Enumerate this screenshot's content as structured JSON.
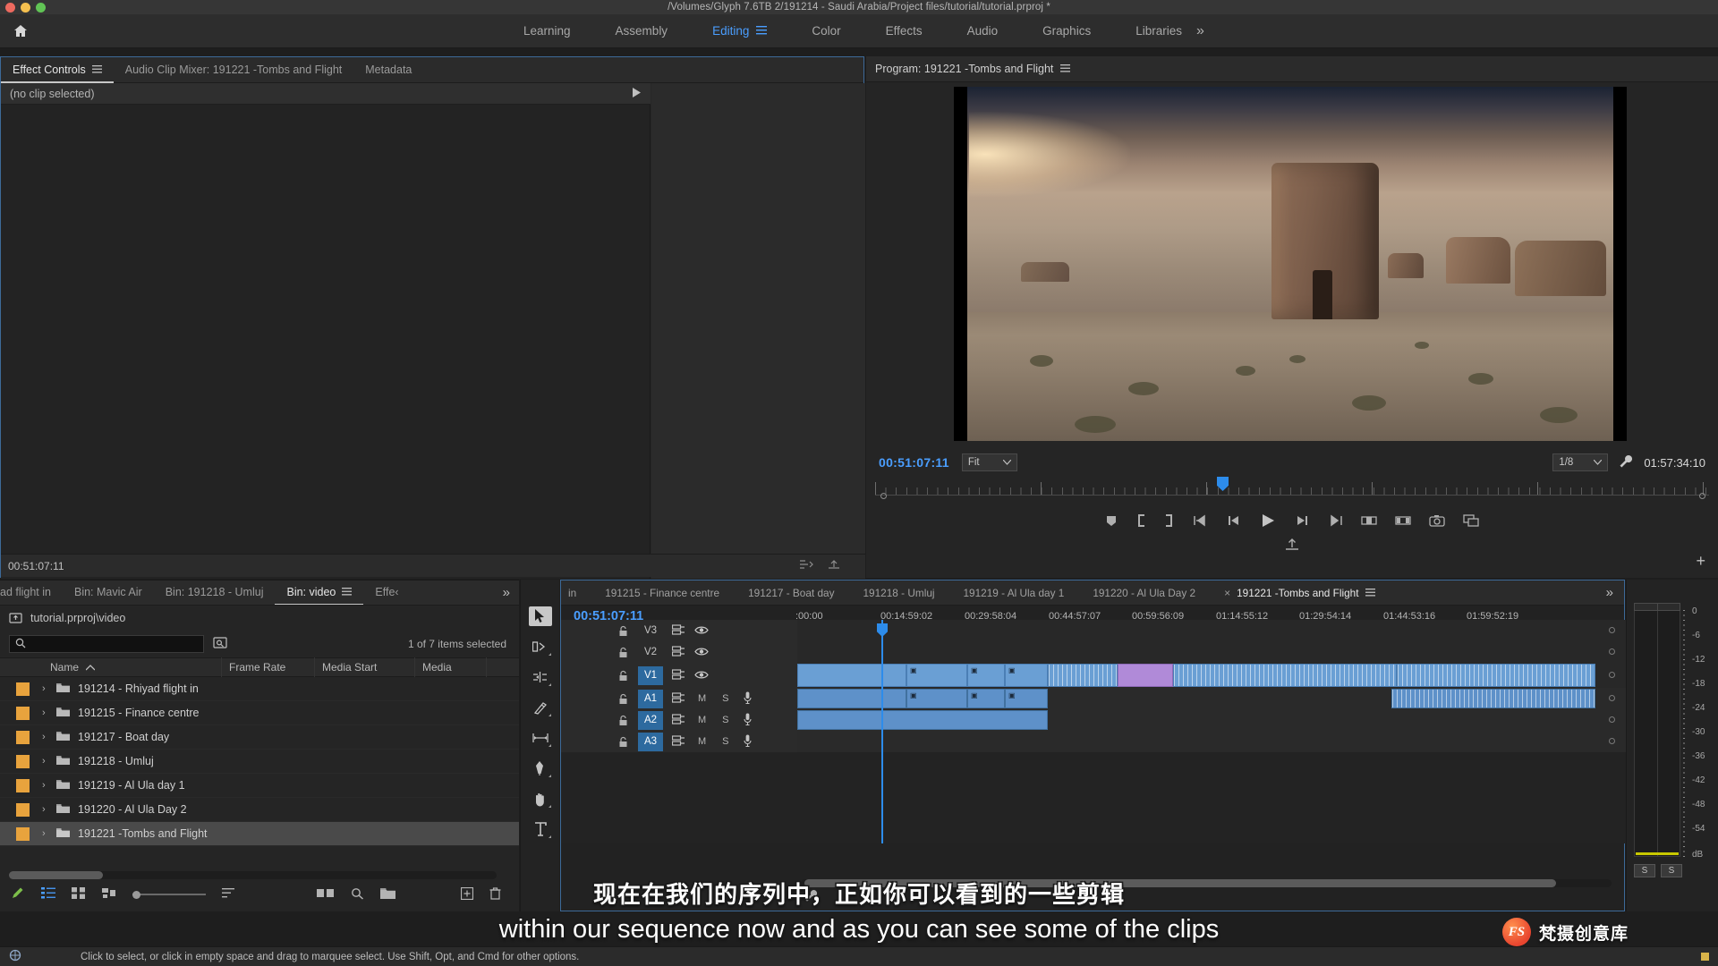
{
  "window": {
    "title": "/Volumes/Glyph 7.6TB 2/191214 - Saudi Arabia/Project files/tutorial/tutorial.prproj *",
    "controls": {
      "close": "close",
      "minimize": "minimize",
      "maximize": "maximize"
    }
  },
  "workspace": {
    "home_icon": "home-icon",
    "tabs": [
      {
        "label": "Learning",
        "active": false
      },
      {
        "label": "Assembly",
        "active": false
      },
      {
        "label": "Editing",
        "active": true,
        "menu_icon": "burger-menu-icon"
      },
      {
        "label": "Color",
        "active": false
      },
      {
        "label": "Effects",
        "active": false
      },
      {
        "label": "Audio",
        "active": false
      },
      {
        "label": "Graphics",
        "active": false
      },
      {
        "label": "Libraries",
        "active": false
      }
    ],
    "overflow_label": "»"
  },
  "effect_controls": {
    "tabs": [
      {
        "label": "Effect Controls",
        "active": true,
        "menu_icon": "burger-menu-icon"
      },
      {
        "label": "Audio Clip Mixer: 191221 -Tombs and Flight",
        "active": false
      },
      {
        "label": "Metadata",
        "active": false
      }
    ],
    "clip_status": "(no clip selected)",
    "expand_icon": "play-triangle-icon",
    "timecode": "00:51:07:11"
  },
  "program_monitor": {
    "title": "Program: 191221 -Tombs and Flight",
    "menu_icon": "burger-menu-icon",
    "current_timecode": "00:51:07:11",
    "zoom_level": "Fit",
    "resolution": "1/8",
    "settings_icon": "wrench-icon",
    "duration_timecode": "01:57:34:10",
    "transport": [
      {
        "name": "add-marker-button",
        "glyph": "marker"
      },
      {
        "name": "mark-in-button",
        "glyph": "mark-in"
      },
      {
        "name": "mark-out-button",
        "glyph": "mark-out"
      },
      {
        "name": "go-to-in-button",
        "glyph": "go-to-in"
      },
      {
        "name": "step-back-button",
        "glyph": "step-back"
      },
      {
        "name": "play-stop-button",
        "glyph": "play"
      },
      {
        "name": "step-forward-button",
        "glyph": "step-forward"
      },
      {
        "name": "go-to-out-button",
        "glyph": "go-to-out"
      },
      {
        "name": "lift-button",
        "glyph": "lift"
      },
      {
        "name": "extract-button",
        "glyph": "extract"
      },
      {
        "name": "export-frame-button",
        "glyph": "camera"
      },
      {
        "name": "comparison-view-button",
        "glyph": "compare"
      }
    ],
    "export_icon": "export-icon",
    "plus_icon": "plus-icon"
  },
  "project_panel": {
    "tabs": [
      {
        "label": "ad flight in",
        "active": false
      },
      {
        "label": "Bin: Mavic Air",
        "active": false
      },
      {
        "label": "Bin: 191218 - Umluj",
        "active": false
      },
      {
        "label": "Bin: video",
        "active": true,
        "menu_icon": "burger-menu-icon"
      },
      {
        "label": "Effe‹",
        "active": false
      }
    ],
    "overflow_label": "»",
    "breadcrumb": "tutorial.prproj\\video",
    "breadcrumb_icon": "folder-up-icon",
    "search_placeholder": "",
    "search_value": "",
    "search_icon": "search-icon",
    "filter_icon": "find-icon",
    "selection_status": "1 of 7 items selected",
    "columns": [
      "Name",
      "Frame Rate",
      "Media Start",
      "Media"
    ],
    "sort_icon": "sort-ascending-icon",
    "rows": [
      {
        "name": "191214 - Rhiyad flight in",
        "frame_rate": "",
        "media_start": "",
        "media": "",
        "selected": false
      },
      {
        "name": "191215 - Finance centre",
        "frame_rate": "",
        "media_start": "",
        "media": "",
        "selected": false
      },
      {
        "name": "191217 - Boat day",
        "frame_rate": "",
        "media_start": "",
        "media": "",
        "selected": false
      },
      {
        "name": "191218 - Umluj",
        "frame_rate": "",
        "media_start": "",
        "media": "",
        "selected": false
      },
      {
        "name": "191219 - Al Ula day 1",
        "frame_rate": "",
        "media_start": "",
        "media": "",
        "selected": false
      },
      {
        "name": "191220 - Al Ula Day 2",
        "frame_rate": "",
        "media_start": "",
        "media": "",
        "selected": false
      },
      {
        "name": "191221 -Tombs and Flight",
        "frame_rate": "",
        "media_start": "",
        "media": "",
        "selected": true
      }
    ],
    "toolbar": [
      {
        "name": "new-item-pen-icon"
      },
      {
        "name": "list-view-icon"
      },
      {
        "name": "icon-view-icon"
      },
      {
        "name": "freeform-view-icon"
      },
      {
        "name": "zoom-slider"
      },
      {
        "name": "sort-icon"
      },
      {
        "name": "automate-to-sequence-icon"
      },
      {
        "name": "find-icon"
      },
      {
        "name": "new-bin-icon"
      },
      {
        "name": "new-item-icon"
      },
      {
        "name": "delete-icon"
      }
    ]
  },
  "tools": [
    {
      "name": "selection-tool",
      "glyph": "▶",
      "active": true
    },
    {
      "name": "track-select-forward-tool",
      "glyph": "track-select"
    },
    {
      "name": "ripple-edit-tool",
      "glyph": "ripple"
    },
    {
      "name": "razor-tool",
      "glyph": "razor"
    },
    {
      "name": "slip-tool",
      "glyph": "slip"
    },
    {
      "name": "pen-tool",
      "glyph": "pen"
    },
    {
      "name": "hand-tool",
      "glyph": "hand"
    },
    {
      "name": "type-tool",
      "glyph": "T"
    }
  ],
  "timeline": {
    "tabs": [
      {
        "label": "in",
        "active": false
      },
      {
        "label": "191215 - Finance centre",
        "active": false
      },
      {
        "label": "191217 - Boat day",
        "active": false
      },
      {
        "label": "191218 - Umluj",
        "active": false
      },
      {
        "label": "191219 - Al Ula day 1",
        "active": false
      },
      {
        "label": "191220 - Al Ula Day 2",
        "active": false
      },
      {
        "label": "191221 -Tombs and Flight",
        "active": true,
        "closable": true,
        "menu_icon": "burger-menu-icon"
      }
    ],
    "overflow_label": "»",
    "current_timecode": "00:51:07:11",
    "header_tools": [
      {
        "name": "sequence-settings-icon"
      },
      {
        "name": "snap-icon"
      },
      {
        "name": "linked-selection-icon"
      },
      {
        "name": "add-marker-icon"
      },
      {
        "name": "timeline-display-settings-icon"
      }
    ],
    "ruler_labels": [
      ":00:00",
      "00:14:59:02",
      "00:29:58:04",
      "00:44:57:07",
      "00:59:56:09",
      "01:14:55:12",
      "01:29:54:14",
      "01:44:53:16",
      "01:59:52:19"
    ],
    "tracks": [
      {
        "id": "V3",
        "type": "video",
        "lock": "unlocked",
        "targeted": false,
        "sync": true,
        "eye": true
      },
      {
        "id": "V2",
        "type": "video",
        "lock": "unlocked",
        "targeted": false,
        "sync": true,
        "eye": true
      },
      {
        "id": "V1",
        "type": "video",
        "lock": "unlocked",
        "targeted": true,
        "sync": true,
        "eye": true
      },
      {
        "id": "A1",
        "type": "audio",
        "lock": "unlocked",
        "targeted": true,
        "sync": true,
        "mute": "M",
        "solo": "S",
        "mic": true
      },
      {
        "id": "A2",
        "type": "audio",
        "lock": "unlocked",
        "targeted": true,
        "sync": true,
        "mute": "M",
        "solo": "S",
        "mic": true
      },
      {
        "id": "A3",
        "type": "audio",
        "lock": "unlocked",
        "targeted": true,
        "sync": true,
        "mute": "M",
        "solo": "S",
        "mic": true
      }
    ]
  },
  "audio_meter": {
    "scale": [
      "0",
      "-6",
      "-12",
      "-18",
      "-24",
      "-30",
      "-36",
      "-42",
      "-48",
      "-54",
      "dB"
    ],
    "solo_buttons": [
      "S",
      "S"
    ]
  },
  "status_bar": {
    "icon": "selection-hint-icon",
    "message": "Click to select, or click in empty space and drag to marquee select. Use Shift, Opt, and Cmd for other options."
  },
  "subtitles": {
    "chinese": "现在在我们的序列中，正如你可以看到的一些剪辑",
    "english": "within our sequence now and as you can see some of the clips"
  },
  "watermark": {
    "logo_text": "FS",
    "brand": "梵摄创意库"
  },
  "colors": {
    "accent_blue": "#4a9eff",
    "panel_bg": "#252525",
    "bin_swatch": "#e8a33d",
    "clip_video": "#6a9fd4",
    "clip_adjust": "#b08ad8",
    "render_bar": "#d2d200"
  }
}
